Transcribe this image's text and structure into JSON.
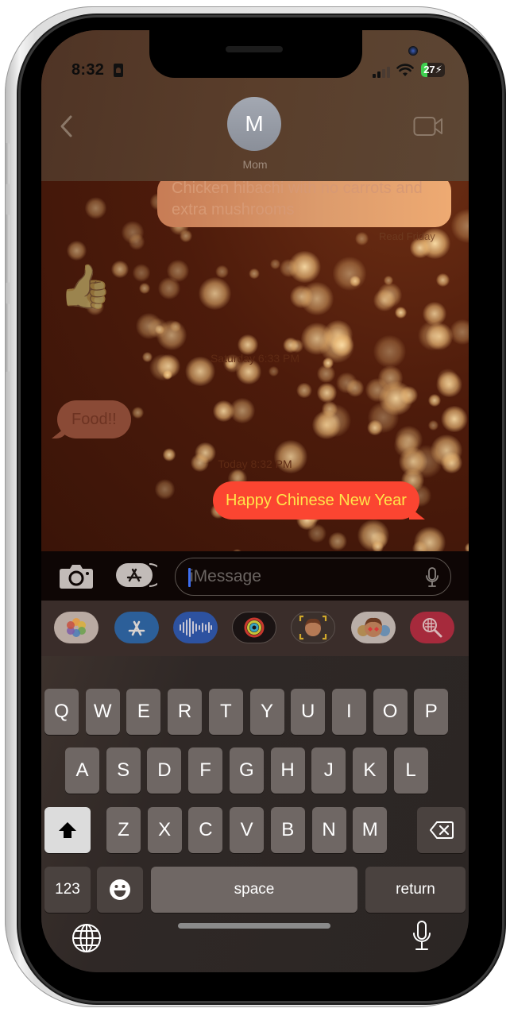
{
  "status_bar": {
    "time": "8:32",
    "battery_percent": "27",
    "battery_level": 0.27,
    "charging": true,
    "signal_bars_active": 2,
    "signal_bars_total": 4
  },
  "header": {
    "back_icon": "chevron-left-icon",
    "contact_initial": "M",
    "contact_name": "Mom",
    "video_icon": "video-camera-icon"
  },
  "messages": [
    {
      "type": "sent",
      "text": "Chicken hibachi with no carrots and extra mushrooms",
      "faded": true
    },
    {
      "type": "receipt",
      "text": "Read Friday"
    },
    {
      "type": "tapback",
      "icon": "thumbs-up-icon",
      "glyph": "👍"
    },
    {
      "type": "timestamp",
      "text": "Saturday 6:33 PM"
    },
    {
      "type": "received",
      "text": "Food!!"
    },
    {
      "type": "timestamp",
      "text": "Today 8:32 PM"
    },
    {
      "type": "sent",
      "text": "Happy Chinese New Year",
      "effect": "celebration"
    }
  ],
  "composer": {
    "placeholder": "iMessage",
    "camera_icon": "camera-icon",
    "apps_icon": "app-store-icon",
    "mic_icon": "microphone-icon"
  },
  "app_drawer": [
    {
      "name": "Photos",
      "icon": "photos-icon",
      "color": "#c9b8ae"
    },
    {
      "name": "App Store",
      "icon": "app-store-icon",
      "color": "#2f6fb8"
    },
    {
      "name": "Audio",
      "icon": "audio-waveform-icon",
      "color": "#2f5fb6"
    },
    {
      "name": "Activity",
      "icon": "activity-rings-icon",
      "color": "#1a1414"
    },
    {
      "name": "Memoji",
      "icon": "memoji-icon",
      "color": "#2c2624"
    },
    {
      "name": "Memoji Stickers",
      "icon": "memoji-stickers-icon",
      "color": "#c8bfb9"
    },
    {
      "name": "Images",
      "icon": "image-search-icon",
      "color": "#d8384f"
    }
  ],
  "keyboard": {
    "row1": [
      "Q",
      "W",
      "E",
      "R",
      "T",
      "Y",
      "U",
      "I",
      "O",
      "P"
    ],
    "row2": [
      "A",
      "S",
      "D",
      "F",
      "G",
      "H",
      "J",
      "K",
      "L"
    ],
    "row3": [
      "Z",
      "X",
      "C",
      "V",
      "B",
      "N",
      "M"
    ],
    "shift_icon": "shift-icon",
    "delete_icon": "backspace-icon",
    "numbers_label": "123",
    "emoji_icon": "emoji-icon",
    "space_label": "space",
    "return_label": "return",
    "globe_icon": "globe-icon",
    "dictation_icon": "microphone-icon"
  }
}
